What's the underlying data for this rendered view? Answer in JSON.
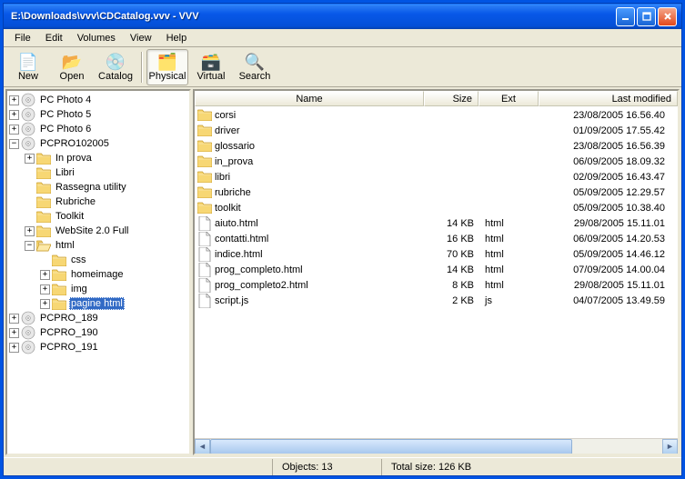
{
  "title": "E:\\Downloads\\vvv\\CDCatalog.vvv - VVV",
  "menu": {
    "file": "File",
    "edit": "Edit",
    "volumes": "Volumes",
    "view": "View",
    "help": "Help"
  },
  "toolbar": {
    "new": "New",
    "open": "Open",
    "catalog": "Catalog",
    "physical": "Physical",
    "virtual": "Virtual",
    "search": "Search"
  },
  "tree": [
    {
      "label": "PC Photo 4",
      "depth": 0,
      "exp": "+",
      "icon": "cd"
    },
    {
      "label": "PC Photo 5",
      "depth": 0,
      "exp": "+",
      "icon": "cd"
    },
    {
      "label": "PC Photo 6",
      "depth": 0,
      "exp": "+",
      "icon": "cd"
    },
    {
      "label": "PCPRO102005",
      "depth": 0,
      "exp": "-",
      "icon": "cd"
    },
    {
      "label": "In prova",
      "depth": 1,
      "exp": "+",
      "icon": "folder"
    },
    {
      "label": "Libri",
      "depth": 1,
      "exp": "",
      "icon": "folder"
    },
    {
      "label": "Rassegna utility",
      "depth": 1,
      "exp": "",
      "icon": "folder"
    },
    {
      "label": "Rubriche",
      "depth": 1,
      "exp": "",
      "icon": "folder"
    },
    {
      "label": "Toolkit",
      "depth": 1,
      "exp": "",
      "icon": "folder"
    },
    {
      "label": "WebSite 2.0 Full",
      "depth": 1,
      "exp": "+",
      "icon": "folder"
    },
    {
      "label": "html",
      "depth": 1,
      "exp": "-",
      "icon": "folder-open"
    },
    {
      "label": "css",
      "depth": 2,
      "exp": "",
      "icon": "folder"
    },
    {
      "label": "homeimage",
      "depth": 2,
      "exp": "+",
      "icon": "folder"
    },
    {
      "label": "img",
      "depth": 2,
      "exp": "+",
      "icon": "folder"
    },
    {
      "label": "pagine html",
      "depth": 2,
      "exp": "+",
      "icon": "folder",
      "selected": true
    },
    {
      "label": "PCPRO_189",
      "depth": 0,
      "exp": "+",
      "icon": "cd"
    },
    {
      "label": "PCPRO_190",
      "depth": 0,
      "exp": "+",
      "icon": "cd"
    },
    {
      "label": "PCPRO_191",
      "depth": 0,
      "exp": "+",
      "icon": "cd"
    }
  ],
  "columns": {
    "name": "Name",
    "size": "Size",
    "ext": "Ext",
    "date": "Last modified"
  },
  "files": [
    {
      "name": "corsi",
      "size": "",
      "ext": "",
      "date": "23/08/2005 16.56.40",
      "type": "folder"
    },
    {
      "name": "driver",
      "size": "",
      "ext": "",
      "date": "01/09/2005 17.55.42",
      "type": "folder"
    },
    {
      "name": "glossario",
      "size": "",
      "ext": "",
      "date": "23/08/2005 16.56.39",
      "type": "folder"
    },
    {
      "name": "in_prova",
      "size": "",
      "ext": "",
      "date": "06/09/2005 18.09.32",
      "type": "folder"
    },
    {
      "name": "libri",
      "size": "",
      "ext": "",
      "date": "02/09/2005 16.43.47",
      "type": "folder"
    },
    {
      "name": "rubriche",
      "size": "",
      "ext": "",
      "date": "05/09/2005 12.29.57",
      "type": "folder"
    },
    {
      "name": "toolkit",
      "size": "",
      "ext": "",
      "date": "05/09/2005 10.38.40",
      "type": "folder"
    },
    {
      "name": "aiuto.html",
      "size": "14 KB",
      "ext": "html",
      "date": "29/08/2005 15.11.01",
      "type": "file"
    },
    {
      "name": "contatti.html",
      "size": "16 KB",
      "ext": "html",
      "date": "06/09/2005 14.20.53",
      "type": "file"
    },
    {
      "name": "indice.html",
      "size": "70 KB",
      "ext": "html",
      "date": "05/09/2005 14.46.12",
      "type": "file"
    },
    {
      "name": "prog_completo.html",
      "size": "14 KB",
      "ext": "html",
      "date": "07/09/2005 14.00.04",
      "type": "file"
    },
    {
      "name": "prog_completo2.html",
      "size": "8 KB",
      "ext": "html",
      "date": "29/08/2005 15.11.01",
      "type": "file"
    },
    {
      "name": "script.js",
      "size": "2 KB",
      "ext": "js",
      "date": "04/07/2005 13.49.59",
      "type": "file"
    }
  ],
  "status": {
    "objects": "Objects: 13",
    "size": "Total size: 126 KB"
  }
}
